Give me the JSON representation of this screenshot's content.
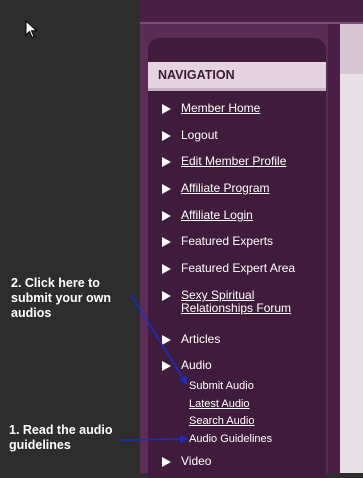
{
  "navigation": {
    "header": "NAVIGATION",
    "items": [
      {
        "label": "Member Home",
        "link": true
      },
      {
        "label": "Logout",
        "link": false
      },
      {
        "label": "Edit Member Profile",
        "link": true
      },
      {
        "label": "Affiliate Program",
        "link": true
      },
      {
        "label": "Affiliate Login",
        "link": true
      },
      {
        "label": "Featured Experts",
        "link": false
      },
      {
        "label": "Featured Expert Area",
        "link": false
      },
      {
        "label_line1": "Sexy Spiritual",
        "label_line2": "Relationships Forum",
        "link": true
      },
      {
        "label": "Articles",
        "link": false
      },
      {
        "label": "Audio",
        "link": false
      },
      {
        "label": "Video",
        "link": false
      }
    ],
    "audio_subitems": [
      {
        "label": "Submit Audio",
        "link": false
      },
      {
        "label": "Latest Audio",
        "link": true
      },
      {
        "label": "Search Audio",
        "link": true
      },
      {
        "label": "Audio Guidelines",
        "link": false
      }
    ]
  },
  "annotations": {
    "submit_line1": "2. Click here to",
    "submit_line2": "submit your own",
    "submit_line3": "audios",
    "read_line1": "1. Read the audio",
    "read_line2": "guidelines"
  },
  "colors": {
    "panel": "#5b2c55",
    "nav_box": "#3f1c3b",
    "header_bg": "#e4d4e2",
    "arrow_line": "#1a2ccf"
  }
}
